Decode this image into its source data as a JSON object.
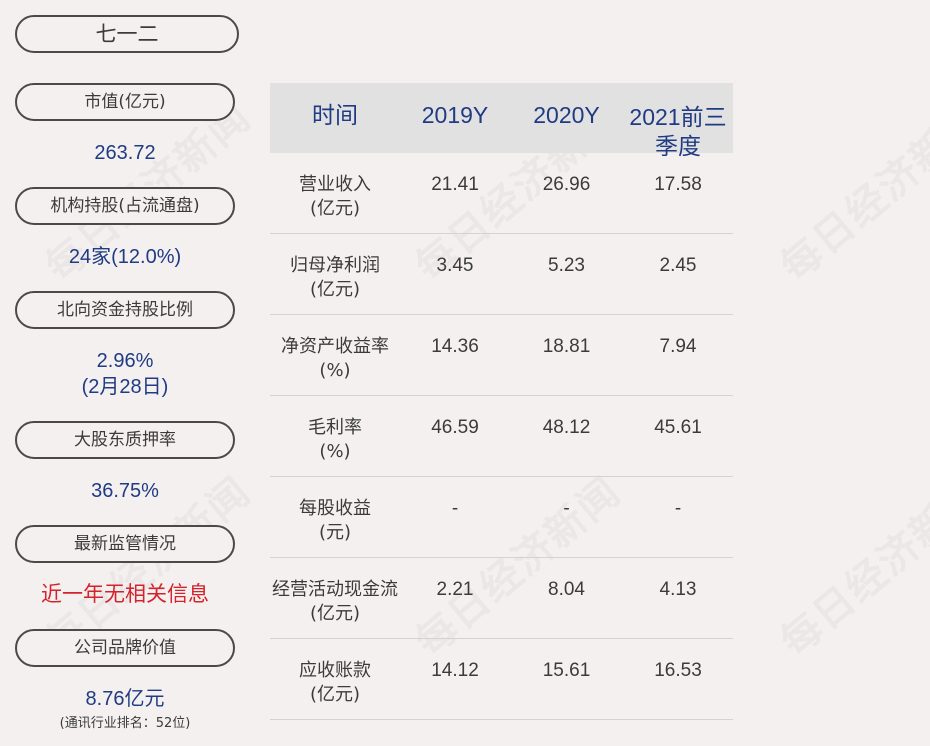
{
  "watermark": "每日经济新闻",
  "company": "七一二",
  "left": {
    "market_cap_label": "市值(亿元)",
    "market_cap_value": "263.72",
    "inst_label": "机构持股(占流通盘)",
    "inst_value": "24家(12.0%)",
    "north_label": "北向资金持股比例",
    "north_value": "2.96%",
    "north_date": "(2月28日)",
    "pledge_label": "大股东质押率",
    "pledge_value": "36.75%",
    "regulation_label": "最新监管情况",
    "regulation_value": "近一年无相关信息",
    "brand_label": "公司品牌价值",
    "brand_value": "8.76亿元",
    "brand_rank": "(通讯行业排名：52位)"
  },
  "table": {
    "headers": [
      "时间",
      "2019Y",
      "2020Y",
      "2021前三季度"
    ],
    "rows": [
      {
        "label": "营业收入\n(亿元)",
        "v2019": "21.41",
        "v2020": "26.96",
        "v2021": "17.58"
      },
      {
        "label": "归母净利润\n(亿元)",
        "v2019": "3.45",
        "v2020": "5.23",
        "v2021": "2.45"
      },
      {
        "label": "净资产收益率\n(%)",
        "v2019": "14.36",
        "v2020": "18.81",
        "v2021": "7.94"
      },
      {
        "label": "毛利率\n(%)",
        "v2019": "46.59",
        "v2020": "48.12",
        "v2021": "45.61"
      },
      {
        "label": "每股收益\n(元)",
        "v2019": "-",
        "v2020": "-",
        "v2021": "-"
      },
      {
        "label": "经营活动现金流\n(亿元)",
        "v2019": "2.21",
        "v2020": "8.04",
        "v2021": "4.13"
      },
      {
        "label": "应收账款\n(亿元)",
        "v2019": "14.12",
        "v2020": "15.61",
        "v2021": "16.53"
      }
    ]
  }
}
